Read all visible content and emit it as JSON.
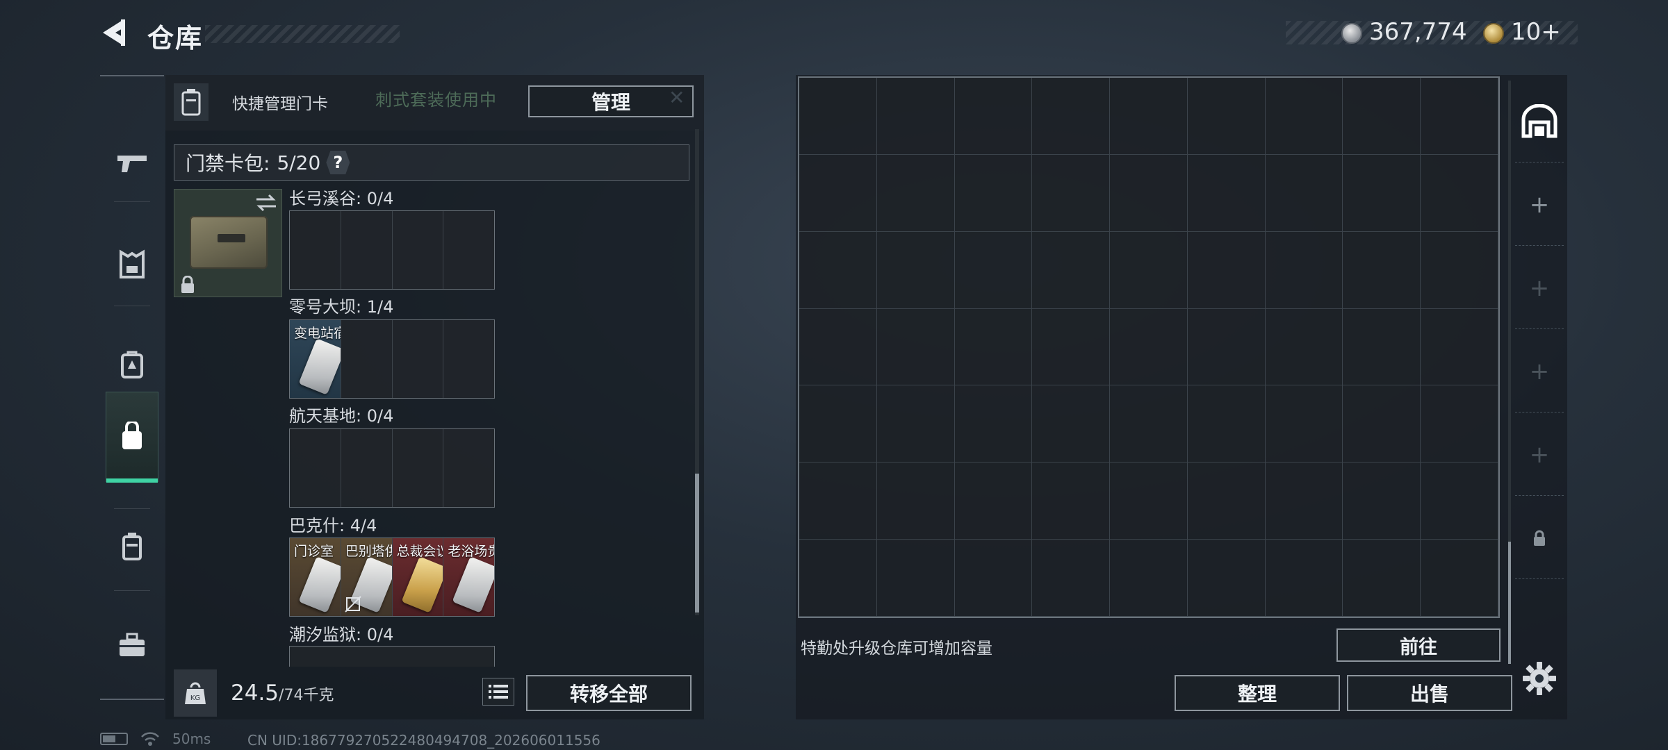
{
  "header": {
    "title": "仓库",
    "currency_silver": "367,774",
    "currency_gold": "10+"
  },
  "quick_manage": {
    "label": "快捷管理门卡",
    "ghost_text": "刺式套装使用中",
    "manage_button": "管理"
  },
  "card_pack": {
    "label": "门禁卡包:",
    "count": "5/20",
    "help": "?"
  },
  "regions": [
    {
      "label": "长弓溪谷: 0/4",
      "slots": [
        {
          "name": "",
          "color": ""
        },
        {
          "name": "",
          "color": ""
        },
        {
          "name": "",
          "color": ""
        },
        {
          "name": "",
          "color": ""
        }
      ]
    },
    {
      "label": "零号大坝: 1/4",
      "slots": [
        {
          "name": "变电站宿舍",
          "color": "blue"
        },
        {
          "name": "",
          "color": ""
        },
        {
          "name": "",
          "color": ""
        },
        {
          "name": "",
          "color": ""
        }
      ]
    },
    {
      "label": "航天基地: 0/4",
      "slots": [
        {
          "name": "",
          "color": ""
        },
        {
          "name": "",
          "color": ""
        },
        {
          "name": "",
          "color": ""
        },
        {
          "name": "",
          "color": ""
        }
      ]
    },
    {
      "label": "巴克什: 4/4",
      "slots": [
        {
          "name": "门诊室",
          "color": "brown"
        },
        {
          "name": "巴别塔供...",
          "color": "brown"
        },
        {
          "name": "总裁会议室",
          "color": "red"
        },
        {
          "name": "老浴场贵...",
          "color": "red"
        }
      ]
    },
    {
      "label": "潮汐监狱: 0/4",
      "slots": []
    }
  ],
  "bottom_left": {
    "weight_current": "24.5",
    "weight_max": "/74千克",
    "transfer_all": "转移全部"
  },
  "storage": {
    "upgrade_hint": "特勤处升级仓库可增加容量",
    "goto_button": "前往",
    "sort_button": "整理",
    "sell_button": "出售"
  },
  "footer": {
    "ping": "50ms",
    "uid": "CN UID:18677927052248049470​8_202606011556"
  },
  "colors": {
    "accent": "#3fd3a4",
    "border": "#8e969e"
  }
}
